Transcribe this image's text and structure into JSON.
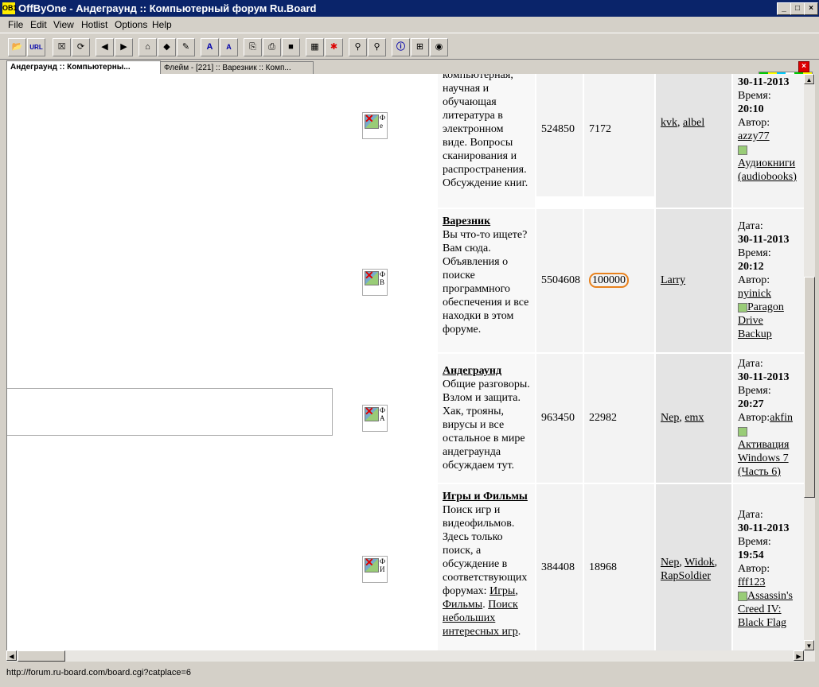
{
  "window": {
    "title": "OffByOne - Андеграунд :: Компьютерный форум Ru.Board",
    "icon_text": "OB1",
    "controls": {
      "minimize": "_",
      "maximize": "□",
      "close": "×"
    }
  },
  "menu": {
    "items": [
      "File",
      "Edit",
      "View",
      "Hotlist",
      "Options",
      "Help"
    ]
  },
  "toolbar": {
    "url_label": "URL",
    "font_up": "A",
    "font_down": "A"
  },
  "tabs": [
    {
      "label": "Андеграунд :: Компьютерны...",
      "active": true
    },
    {
      "label": "Флейм - [221] :: Варезник :: Комп...",
      "active": false
    }
  ],
  "tab_close": "×",
  "forums": [
    {
      "icon_text": "Ф е",
      "name": "",
      "description": "компьютерная, научная и обучающая литература в электронном виде. Вопросы сканирования и распространения. Обсуждение книг.",
      "topics": "524850",
      "posts": "7172",
      "moderators": [
        "kvk",
        "albel"
      ],
      "last": {
        "date_label": "",
        "date": "30-11-2013",
        "time_label": "Время:",
        "time": "20:10",
        "author_label": "Автор:",
        "author": "azzy77",
        "topic": "Аудиокниги (audiobooks)"
      }
    },
    {
      "icon_text": "Ф В",
      "name": "Варезник",
      "description": "Вы что-то ищете? Вам сюда. Объявления о поиске программного обеспечения и все находки в этом форуме.",
      "topics": "5504608",
      "posts": "100000",
      "moderators": [
        "Larry"
      ],
      "last": {
        "date_label": "Дата:",
        "date": "30-11-2013",
        "time_label": "Время:",
        "time": "20:12",
        "author_label": "Автор:",
        "author": "nyinick",
        "topic": "Paragon Drive Backup"
      }
    },
    {
      "icon_text": "Ф А",
      "name": "Андеграунд",
      "description": "Общие разговоры. Взлом и защита. Хак, трояны, вирусы и все остальное в мире андеграунда обсуждаем тут.",
      "topics": "963450",
      "posts": "22982",
      "moderators": [
        "Nep",
        "emx"
      ],
      "last": {
        "date_label": "Дата:",
        "date": "30-11-2013",
        "time_label": "Время:",
        "time": "20:27",
        "author_label": "Автор:",
        "author": "akfin",
        "topic": "Активация Windows 7 (Часть 6)"
      }
    },
    {
      "icon_text": "Ф И",
      "name": "Игры и Фильмы",
      "description": "Поиск игр и видеофильмов. Здесь только поиск, а обсуждение в соответствующих форумах:",
      "links": [
        "Игры",
        "Фильмы",
        "Поиск небольших интересных игр"
      ],
      "topics": "384408",
      "posts": "18968",
      "moderators": [
        "Nep",
        "Widok",
        "RapSoldier"
      ],
      "last": {
        "date_label": "Дата:",
        "date": "30-11-2013",
        "time_label": "Время:",
        "time": "19:54",
        "author_label": "Автор:",
        "author": "fff123",
        "topic": "Assassin's Creed IV: Black Flag"
      }
    }
  ],
  "status": {
    "url": "http://forum.ru-board.com/board.cgi?catplace=6"
  }
}
